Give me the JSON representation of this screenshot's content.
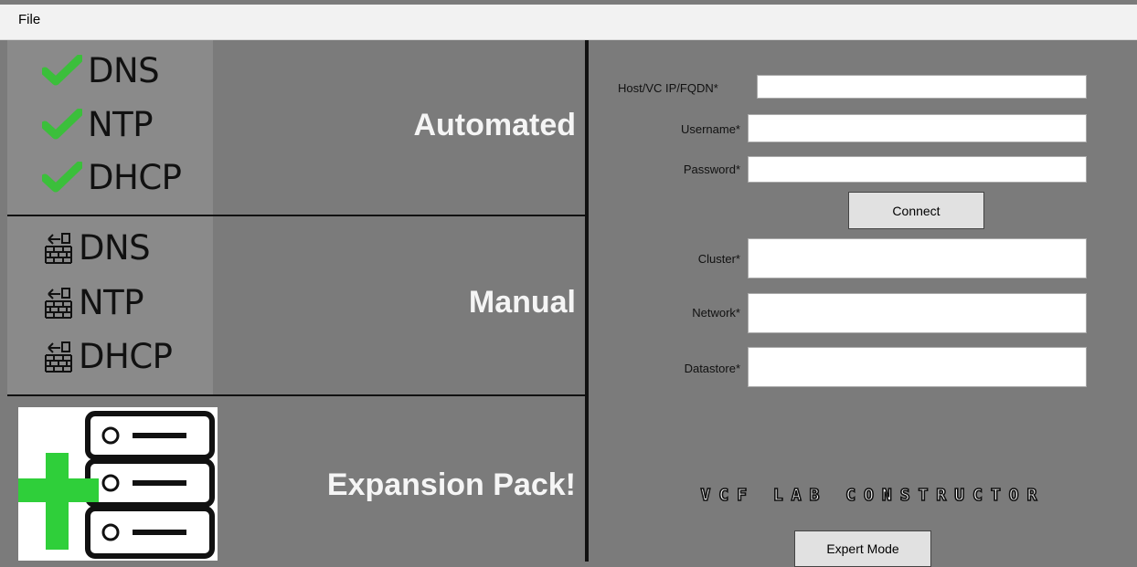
{
  "menu": {
    "file": "File"
  },
  "tiles": {
    "automated": {
      "title": "Automated",
      "items": [
        "DNS",
        "NTP",
        "DHCP"
      ],
      "icon": "check-icon",
      "icon_color": "#3bbf3b"
    },
    "manual": {
      "title": "Manual",
      "items": [
        "DNS",
        "NTP",
        "DHCP"
      ],
      "icon": "manual-config-icon"
    },
    "expansion": {
      "title": "Expansion Pack!",
      "icon": "server-stack-plus-icon",
      "plus_color": "#2fcf3a"
    }
  },
  "form": {
    "host_label": "Host/VC IP/FQDN*",
    "host_value": "",
    "username_label": "Username*",
    "username_value": "",
    "password_label": "Password*",
    "password_value": "",
    "connect_label": "Connect",
    "cluster_label": "Cluster*",
    "cluster_value": "",
    "network_label": "Network*",
    "network_value": "",
    "datastore_label": "Datastore*",
    "datastore_value": ""
  },
  "logo_text": "VCF LAB CONSTRUCTOR",
  "expert_mode_label": "Expert Mode"
}
